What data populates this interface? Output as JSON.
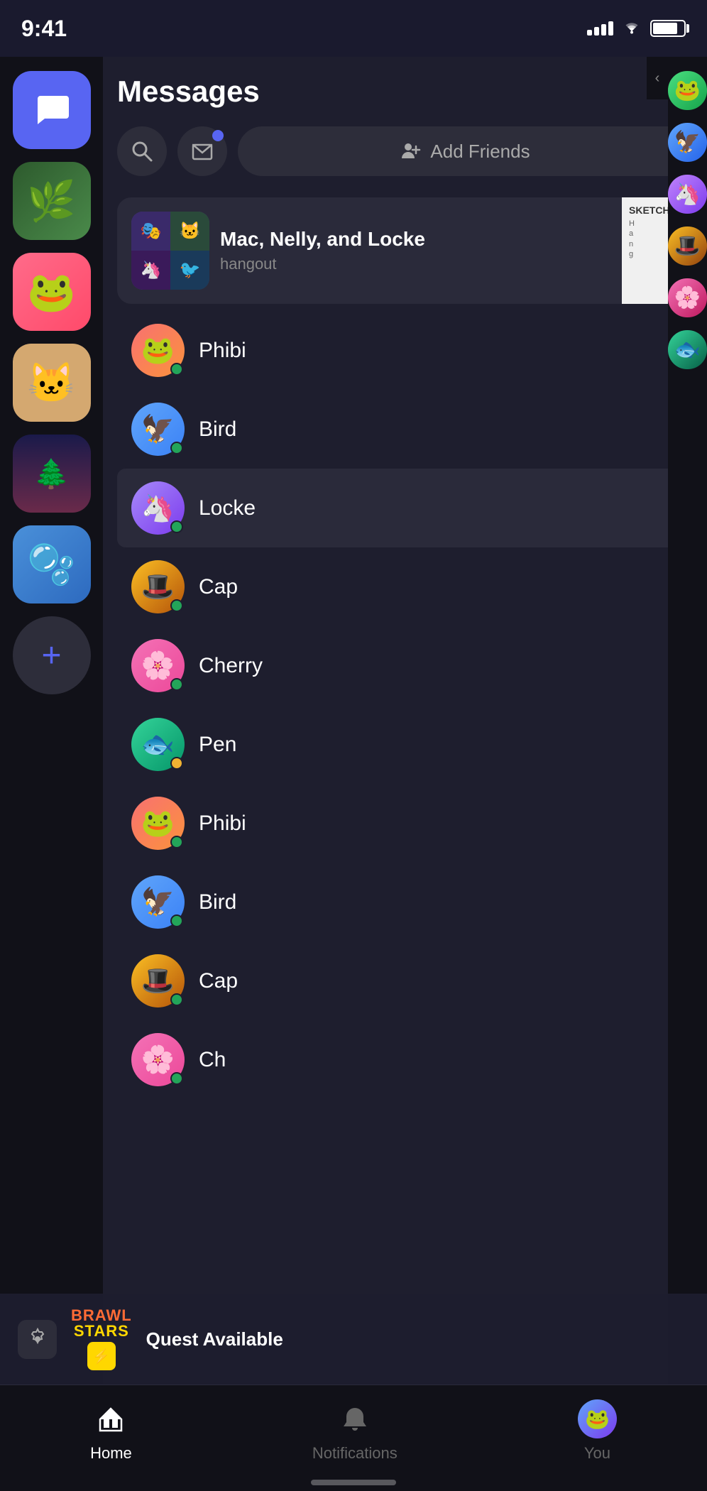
{
  "statusBar": {
    "time": "9:41",
    "signalBars": [
      3,
      5,
      7,
      9,
      11
    ],
    "batteryPercent": 80
  },
  "sidebar": {
    "icons": [
      {
        "id": "messages",
        "type": "active",
        "emoji": "💬"
      },
      {
        "id": "plant",
        "type": "plant"
      },
      {
        "id": "frog",
        "type": "frog"
      },
      {
        "id": "cat",
        "type": "cat"
      },
      {
        "id": "sunset",
        "type": "sunset"
      },
      {
        "id": "blob",
        "type": "blob"
      }
    ],
    "addButton": "+"
  },
  "rightSidebar": {
    "avatars": [
      "🐸",
      "🦅",
      "🦄",
      "🎩",
      "🌸",
      "🐟"
    ]
  },
  "messages": {
    "title": "Messages",
    "searchPlaceholder": "Search",
    "addFriendsLabel": "Add Friends",
    "groupChat": {
      "name": "Mac, Nelly, and Locke",
      "subtitle": "hangout",
      "muted": true,
      "avatarEmojis": [
        "🎭",
        "🐱",
        "🦄",
        "🐦"
      ]
    },
    "dmList": [
      {
        "name": "Phibi",
        "status": "online",
        "avatarClass": "av-phibi",
        "emoji": "🐸"
      },
      {
        "name": "Bird",
        "status": "online",
        "avatarClass": "av-bird",
        "emoji": "🦅"
      },
      {
        "name": "Locke",
        "status": "online",
        "avatarClass": "av-locke",
        "emoji": "🦄",
        "active": true
      },
      {
        "name": "Cap",
        "status": "online",
        "avatarClass": "av-cap",
        "emoji": "🎩"
      },
      {
        "name": "Cherry",
        "status": "online",
        "avatarClass": "av-cherry",
        "emoji": "🌸"
      },
      {
        "name": "Pen",
        "status": "away",
        "avatarClass": "av-pen",
        "emoji": "🐟"
      },
      {
        "name": "Phibi",
        "status": "online",
        "avatarClass": "av-phibi",
        "emoji": "🐸"
      },
      {
        "name": "Bird",
        "status": "online",
        "avatarClass": "av-bird",
        "emoji": "🦅"
      },
      {
        "name": "Cap",
        "status": "online",
        "avatarClass": "av-cap",
        "emoji": "🎩"
      },
      {
        "name": "Ch",
        "status": "online",
        "avatarClass": "av-cherry",
        "emoji": "🌸"
      }
    ]
  },
  "notification": {
    "appName": "BRAWL STARS",
    "message": "Quest Available"
  },
  "bottomNav": {
    "items": [
      {
        "id": "home",
        "label": "Home",
        "icon": "🏠",
        "active": true
      },
      {
        "id": "notifications",
        "label": "Notifications",
        "icon": "🔔",
        "active": false
      },
      {
        "id": "you",
        "label": "You",
        "icon": "avatar",
        "active": false
      }
    ]
  }
}
